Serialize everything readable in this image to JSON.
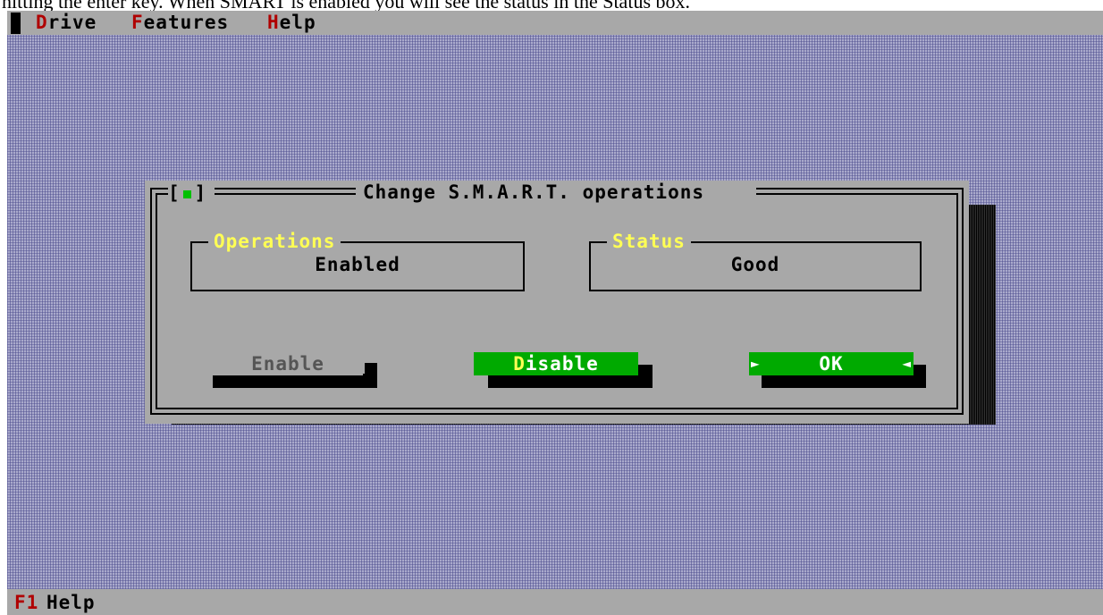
{
  "caption": "hitting the enter key. When SMART is enabled you will see the status in the Status box.",
  "menu": {
    "items": [
      {
        "hotkey": "D",
        "rest": "rive"
      },
      {
        "hotkey": "F",
        "rest": "eatures"
      },
      {
        "hotkey": "H",
        "rest": "elp"
      }
    ]
  },
  "dialog": {
    "title": "Change S.M.A.R.T. operations",
    "close_box": "[■]",
    "operations": {
      "legend": "Operations",
      "value": "Enabled"
    },
    "status": {
      "legend": "Status",
      "value": "Good"
    },
    "buttons": {
      "enable": "Enable",
      "disable_hotkey": "D",
      "disable_rest": "isable",
      "ok": "OK"
    }
  },
  "statusbar": {
    "key": "F1",
    "label": "Help"
  },
  "colors": {
    "menubar": "#a8a8a8",
    "hotkey": "#b00000",
    "desktop": "#aaaacc",
    "button_green": "#00aa00",
    "legend_yellow": "#ffff55"
  }
}
